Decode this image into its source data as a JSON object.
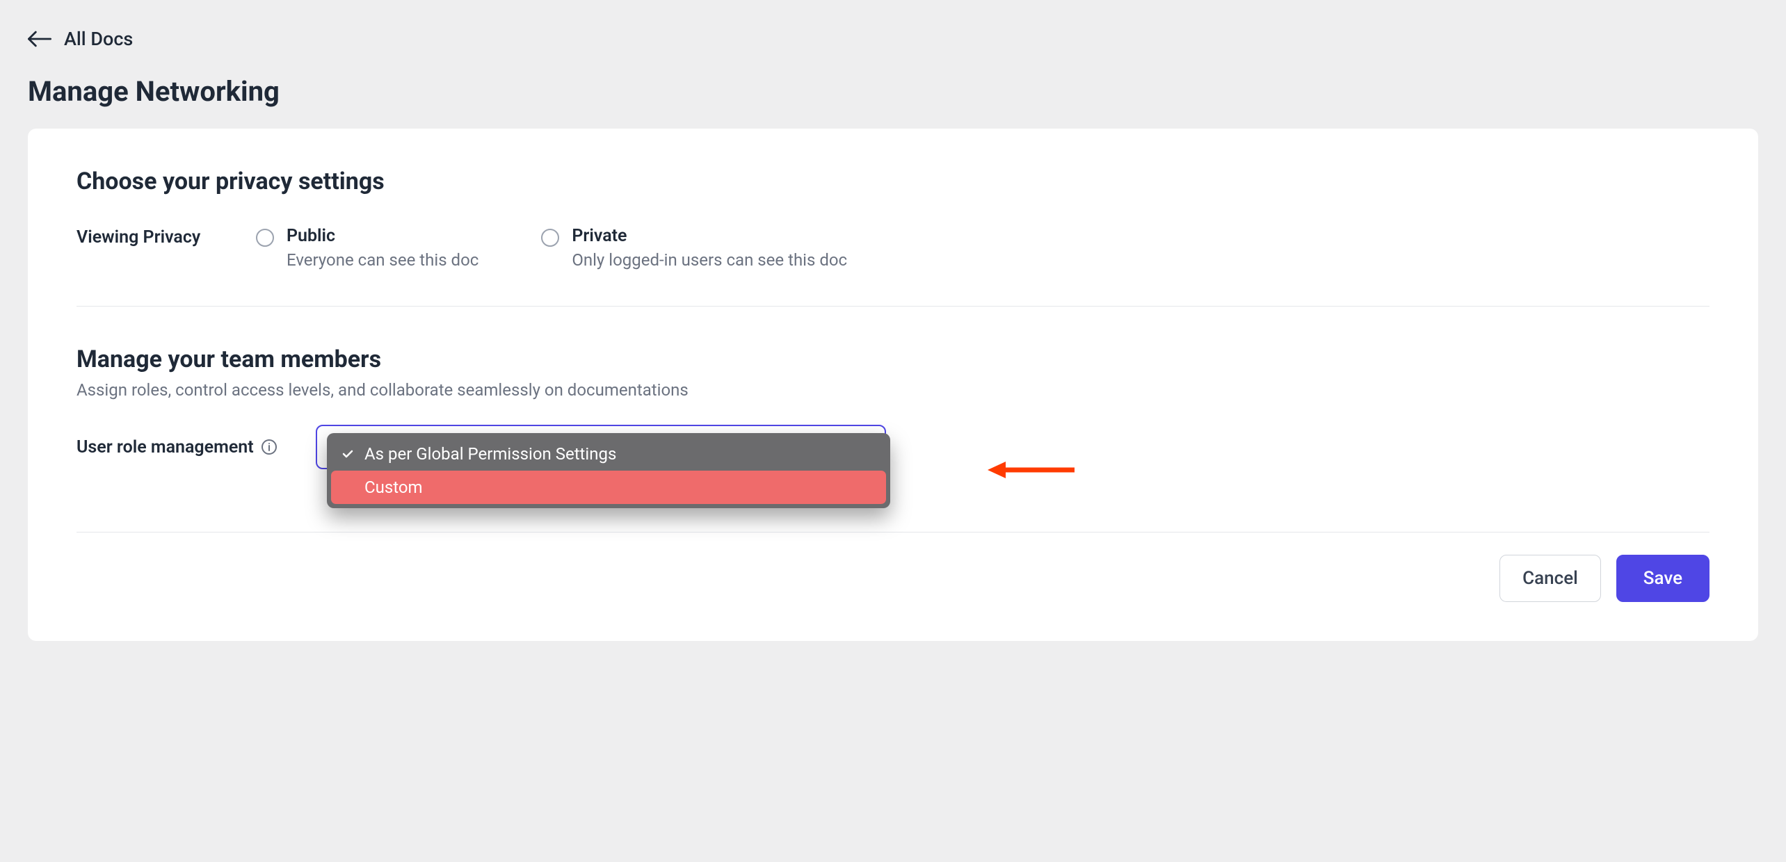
{
  "breadcrumb": {
    "back_label": "All Docs"
  },
  "page_title": "Manage Networking",
  "privacy_section": {
    "heading": "Choose your privacy settings",
    "row_label": "Viewing Privacy",
    "options": [
      {
        "title": "Public",
        "description": "Everyone can see this doc"
      },
      {
        "title": "Private",
        "description": "Only logged-in users can see this doc"
      }
    ]
  },
  "team_section": {
    "heading": "Manage your team members",
    "description": "Assign roles, control access levels, and collaborate seamlessly on documentations",
    "row_label": "User role management",
    "dropdown": {
      "options": [
        {
          "label": "As per Global Permission Settings",
          "selected": true
        },
        {
          "label": "Custom",
          "selected": false,
          "highlighted": true
        }
      ]
    }
  },
  "footer": {
    "cancel_label": "Cancel",
    "save_label": "Save"
  },
  "colors": {
    "accent": "#4f46e5",
    "highlight": "#ef6b6b",
    "annotation_arrow": "#ff3b00"
  }
}
